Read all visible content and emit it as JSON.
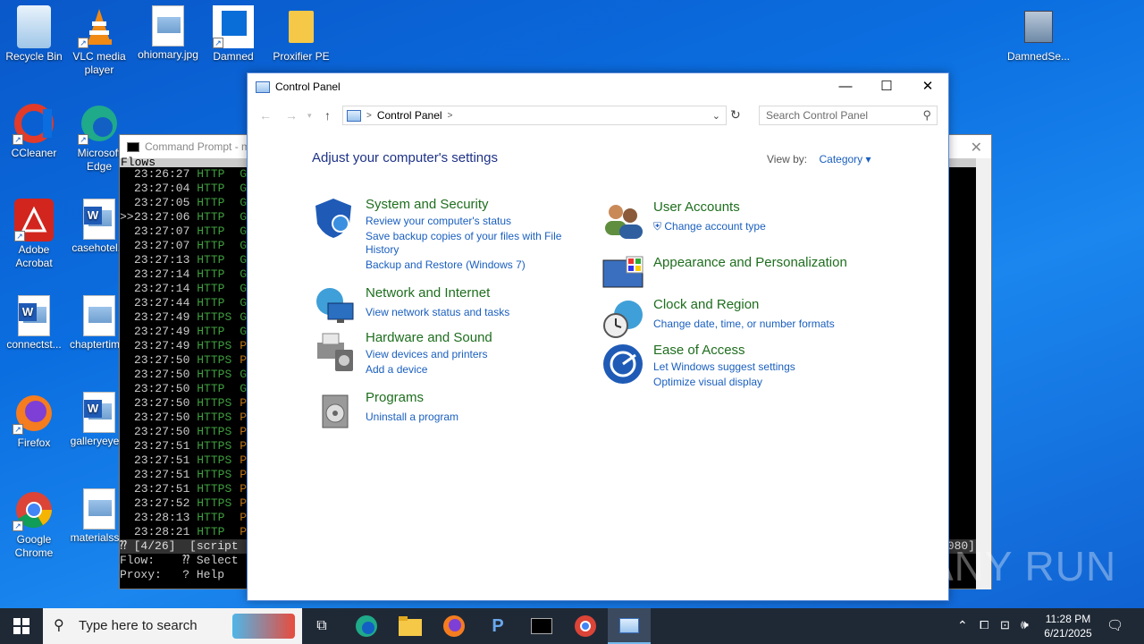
{
  "desktop": {
    "icons": [
      {
        "label": "Recycle Bin"
      },
      {
        "label": "VLC media player"
      },
      {
        "label": "ohiomary.jpg"
      },
      {
        "label": "Damned"
      },
      {
        "label": "Proxifier PE"
      },
      {
        "label": "CCleaner"
      },
      {
        "label": "Microsoft Edge"
      },
      {
        "label": "Adobe Acrobat"
      },
      {
        "label": "casehotel..."
      },
      {
        "label": "connectst..."
      },
      {
        "label": "chaptertim..."
      },
      {
        "label": "Firefox"
      },
      {
        "label": "galleryeye..."
      },
      {
        "label": "Google Chrome"
      },
      {
        "label": "materialss..."
      },
      {
        "label": "DamnedSe..."
      }
    ]
  },
  "cmd": {
    "title": "Command Prompt - m",
    "header": "Flows",
    "rows": [
      {
        "time": "23:26:27",
        "proto": "HTTP",
        "m": "G"
      },
      {
        "time": "23:27:04",
        "proto": "HTTP",
        "m": "G"
      },
      {
        "time": "23:27:05",
        "proto": "HTTP",
        "m": "G"
      },
      {
        "time": "23:27:06",
        "proto": "HTTP",
        "m": "G",
        "mark": ">>"
      },
      {
        "time": "23:27:07",
        "proto": "HTTP",
        "m": "G"
      },
      {
        "time": "23:27:07",
        "proto": "HTTP",
        "m": "G"
      },
      {
        "time": "23:27:13",
        "proto": "HTTP",
        "m": "G"
      },
      {
        "time": "23:27:14",
        "proto": "HTTP",
        "m": "G"
      },
      {
        "time": "23:27:14",
        "proto": "HTTP",
        "m": "G"
      },
      {
        "time": "23:27:44",
        "proto": "HTTP",
        "m": "G"
      },
      {
        "time": "23:27:49",
        "proto": "HTTPS",
        "m": "G"
      },
      {
        "time": "23:27:49",
        "proto": "HTTP",
        "m": "G"
      },
      {
        "time": "23:27:49",
        "proto": "HTTPS",
        "m": "P"
      },
      {
        "time": "23:27:50",
        "proto": "HTTPS",
        "m": "P"
      },
      {
        "time": "23:27:50",
        "proto": "HTTPS",
        "m": "G"
      },
      {
        "time": "23:27:50",
        "proto": "HTTP",
        "m": "G"
      },
      {
        "time": "23:27:50",
        "proto": "HTTPS",
        "m": "P"
      },
      {
        "time": "23:27:50",
        "proto": "HTTPS",
        "m": "P"
      },
      {
        "time": "23:27:50",
        "proto": "HTTPS",
        "m": "P"
      },
      {
        "time": "23:27:51",
        "proto": "HTTPS",
        "m": "P"
      },
      {
        "time": "23:27:51",
        "proto": "HTTPS",
        "m": "P"
      },
      {
        "time": "23:27:51",
        "proto": "HTTPS",
        "m": "P"
      },
      {
        "time": "23:27:51",
        "proto": "HTTPS",
        "m": "P"
      },
      {
        "time": "23:27:52",
        "proto": "HTTPS",
        "m": "P"
      },
      {
        "time": "23:28:13",
        "proto": "HTTP",
        "m": "P"
      },
      {
        "time": "23:28:21",
        "proto": "HTTP",
        "m": "P"
      }
    ],
    "status_line": "⁇ [4/26]  [script",
    "status_right": "080]",
    "footer1": "Flow:    ⁇ Select",
    "footer2": "Proxy:   ? Help"
  },
  "control_panel": {
    "window_title": "Control Panel",
    "address": "Control Panel",
    "search_placeholder": "Search Control Panel",
    "heading": "Adjust your computer's settings",
    "view_by_label": "View by:",
    "view_by_value": "Category",
    "categories": [
      {
        "title": "System and Security",
        "links": [
          "Review your computer's status",
          "Save backup copies of your files with File",
          "History",
          "Backup and Restore (Windows 7)"
        ]
      },
      {
        "title": "Network and Internet",
        "links": [
          "View network status and tasks"
        ]
      },
      {
        "title": "Hardware and Sound",
        "links": [
          "View devices and printers",
          "Add a device"
        ]
      },
      {
        "title": "Programs",
        "links": [
          "Uninstall a program"
        ]
      },
      {
        "title": "User Accounts",
        "links": [
          "Change account type"
        ]
      },
      {
        "title": "Appearance and Personalization",
        "links": []
      },
      {
        "title": "Clock and Region",
        "links": [
          "Change date, time, or number formats"
        ]
      },
      {
        "title": "Ease of Access",
        "links": [
          "Let Windows suggest settings",
          "Optimize visual display"
        ]
      }
    ]
  },
  "taskbar": {
    "search_placeholder": "Type here to search",
    "time": "11:28 PM",
    "date": "6/21/2025"
  },
  "watermark": "ANY RUN"
}
